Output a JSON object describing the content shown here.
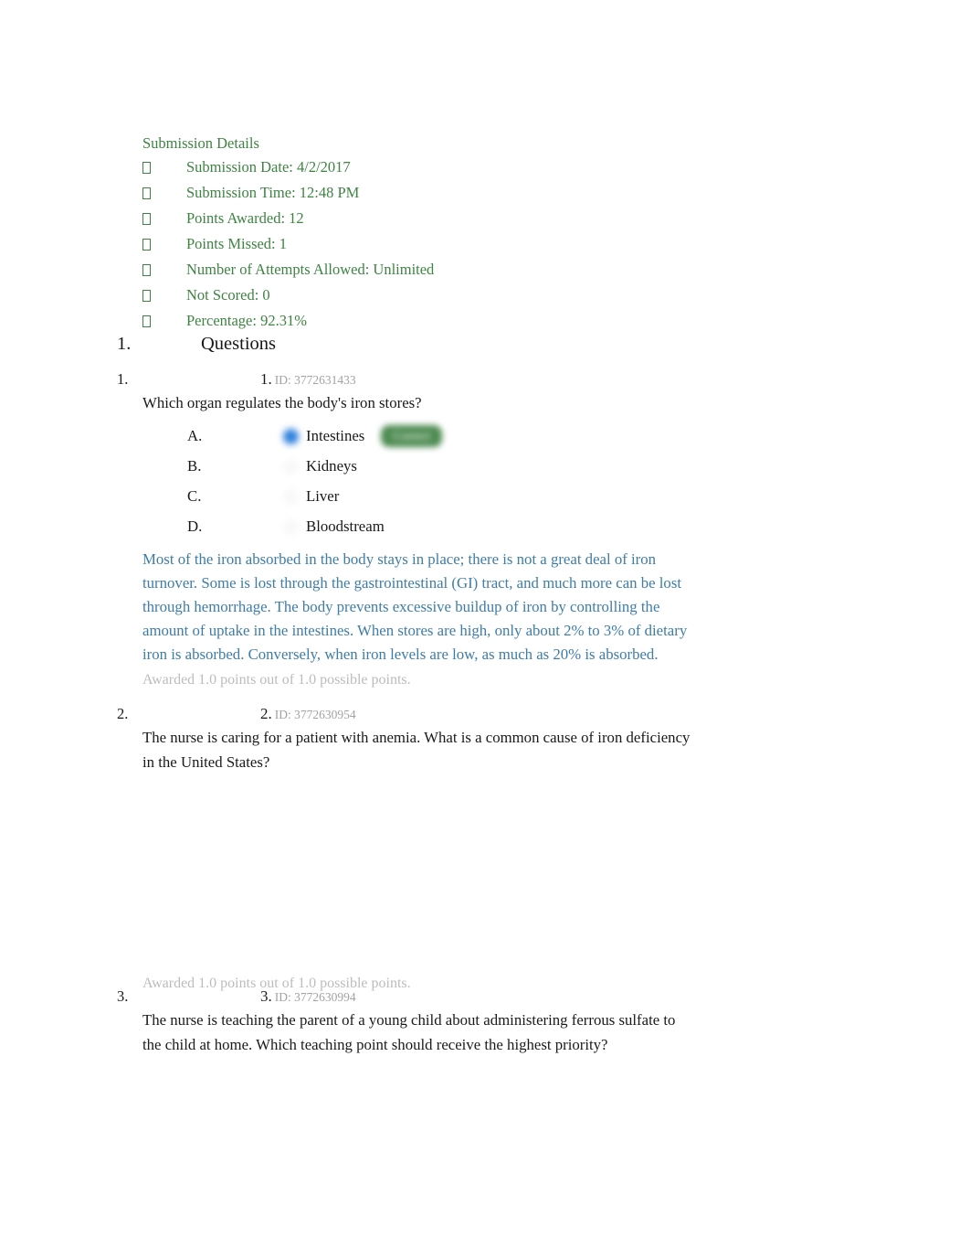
{
  "document": {
    "submission_details": {
      "title": "Submission Details",
      "bullet_icon": "missing-glyph-box",
      "items": [
        "Submission Date: 4/2/2017",
        "Submission Time: 12:48 PM",
        "Points Awarded: 12",
        "Points Missed: 1",
        "Number of Attempts Allowed: Unlimited",
        "Not Scored: 0",
        "Percentage: 92.31%"
      ]
    },
    "questions_section": {
      "number": "1.",
      "label": "Questions"
    },
    "questions": [
      {
        "outer_number": "1.",
        "inner_number": "1.",
        "id_label": "ID: 3772631433",
        "stem": "Which organ regulates the body's iron stores?",
        "options": [
          {
            "letter": "A.",
            "text": "Intestines",
            "selected": true,
            "badge": "Correct"
          },
          {
            "letter": "B.",
            "text": "Kidneys",
            "selected": false,
            "badge": ""
          },
          {
            "letter": "C.",
            "text": "Liver",
            "selected": false,
            "badge": ""
          },
          {
            "letter": "D.",
            "text": "Bloodstream",
            "selected": false,
            "badge": ""
          }
        ],
        "explanation": "Most of the iron absorbed in the body stays in place; there is not a great deal of iron turnover. Some is lost through the gastrointestinal (GI) tract, and much more can be lost through hemorrhage. The body prevents excessive buildup of iron by controlling the amount of uptake in the intestines. When stores are high, only about 2% to 3% of dietary iron is absorbed. Conversely, when iron levels are low, as much as 20% is absorbed.",
        "awarded": "Awarded 1.0 points out of 1.0 possible points."
      },
      {
        "outer_number": "2.",
        "inner_number": "2.",
        "id_label": "ID: 3772630954",
        "stem": "The nurse is caring for a patient with anemia. What is a common cause of iron deficiency in the United States?",
        "awarded": "Awarded 1.0 points out of 1.0 possible points."
      },
      {
        "outer_number": "3.",
        "inner_number": "3.",
        "id_label": "ID: 3772630994",
        "stem": "The nurse is teaching the parent of a young child about administering ferrous sulfate to the child at home. Which teaching point should receive the highest priority?"
      }
    ],
    "colors": {
      "details_green": "#3f8343",
      "explanation_blue": "#3d7da9",
      "awarded_grey": "#bcbcbc",
      "id_grey": "#a3a3a3",
      "correct_badge_green": "#4e8b52",
      "selected_radio_blue": "#2d80dd",
      "body_text": "#1a1a1a"
    }
  }
}
